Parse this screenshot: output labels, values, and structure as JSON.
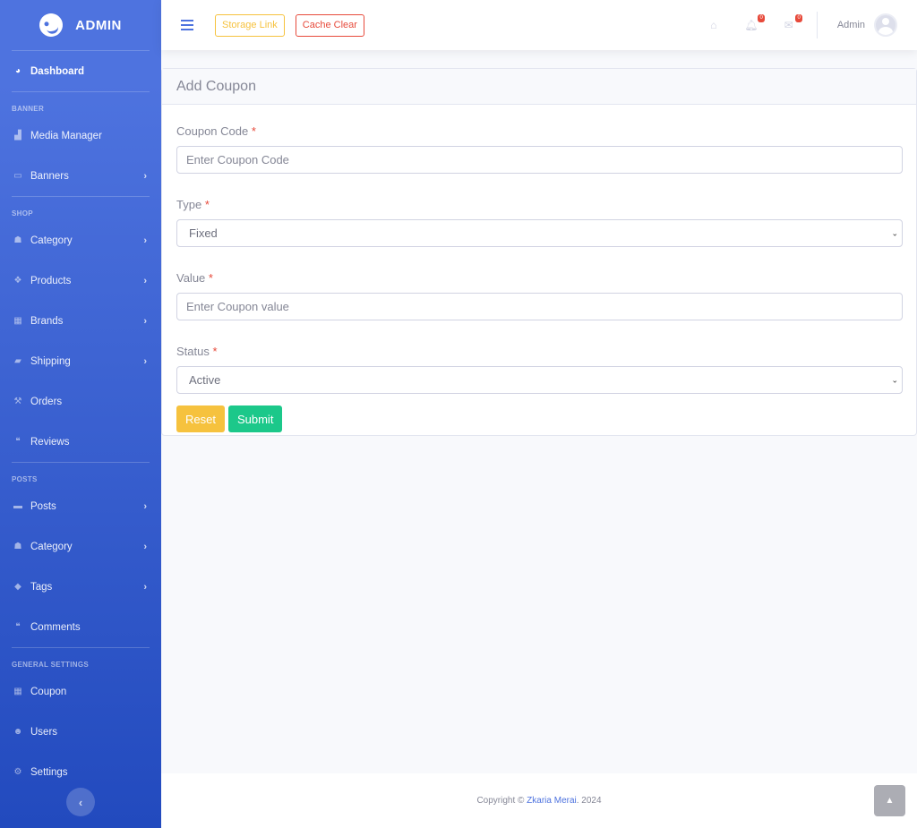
{
  "brand": {
    "name": "ADMIN"
  },
  "sidebar": {
    "dashboard": "Dashboard",
    "headings": {
      "banner": "BANNER",
      "shop": "SHOP",
      "posts": "POSTS",
      "general": "GENERAL SETTINGS"
    },
    "items": {
      "media_manager": "Media Manager",
      "banners": "Banners",
      "category": "Category",
      "products": "Products",
      "brands": "Brands",
      "shipping": "Shipping",
      "orders": "Orders",
      "reviews": "Reviews",
      "posts": "Posts",
      "post_category": "Category",
      "tags": "Tags",
      "comments": "Comments",
      "coupon": "Coupon",
      "users": "Users",
      "settings": "Settings"
    }
  },
  "topbar": {
    "storage_link": "Storage Link",
    "cache_clear": "Cache Clear",
    "notifications_count": "0",
    "messages_count": "0",
    "user_name": "Admin"
  },
  "page": {
    "title": "Add Coupon",
    "required_marker": "*",
    "fields": {
      "code_label": "Coupon Code",
      "code_placeholder": "Enter Coupon Code",
      "type_label": "Type",
      "type_value": "Fixed",
      "value_label": "Value",
      "value_placeholder": "Enter Coupon value",
      "status_label": "Status",
      "status_value": "Active"
    },
    "buttons": {
      "reset": "Reset",
      "submit": "Submit"
    }
  },
  "footer": {
    "prefix": "Copyright ©",
    "author": "Zkaria Merai",
    "suffix": ". 2024"
  }
}
